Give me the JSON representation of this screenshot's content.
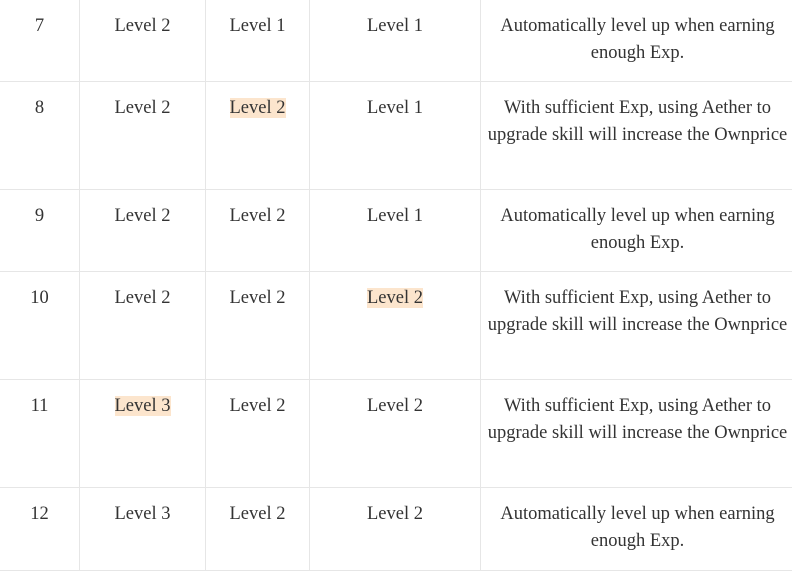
{
  "highlight_color": "#fce5cd",
  "rows": [
    {
      "num": "7",
      "c1": "Level 2",
      "c2": "Level 1",
      "c3": "Level 1",
      "note": "Automatically level up when earning enough Exp."
    },
    {
      "num": "8",
      "c1": "Level 2",
      "c2": "Level 2",
      "c3": "Level 1",
      "note": "With sufficient Exp, using Aether to upgrade skill will increase the Ownprice"
    },
    {
      "num": "9",
      "c1": "Level 2",
      "c2": "Level 2",
      "c3": "Level 1",
      "note": "Automatically level up when earning enough Exp."
    },
    {
      "num": "10",
      "c1": "Level 2",
      "c2": "Level 2",
      "c3": "Level 2",
      "note": "With sufficient Exp, using Aether to upgrade skill will increase the Ownprice"
    },
    {
      "num": "11",
      "c1": "Level 3",
      "c2": "Level 2",
      "c3": "Level 2",
      "note": "With sufficient Exp, using Aether to upgrade skill will increase the Ownprice"
    },
    {
      "num": "12",
      "c1": "Level 3",
      "c2": "Level 2",
      "c3": "Level 2",
      "note": "Automatically level up when earning enough Exp."
    }
  ]
}
